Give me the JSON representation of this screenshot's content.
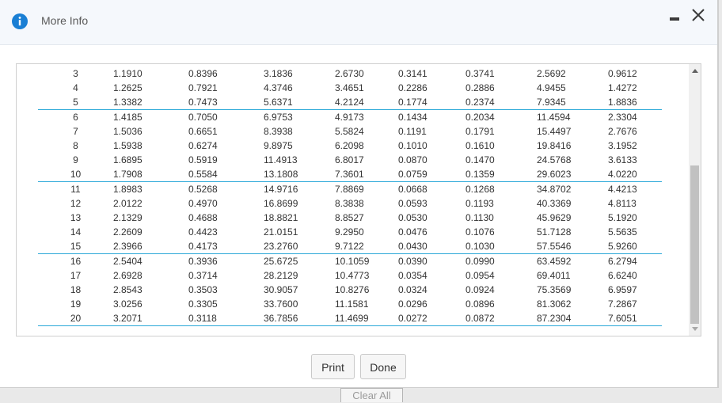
{
  "dialog": {
    "title": "More Info",
    "print_label": "Print",
    "done_label": "Done"
  },
  "underlay": {
    "clear_all_label": "Clear All"
  },
  "colors": {
    "info_icon": "#1a7fd4",
    "row_separator": "#2aa8d8"
  },
  "table": {
    "rows": [
      [
        "3",
        "1.1910",
        "0.8396",
        "3.1836",
        "2.6730",
        "0.3141",
        "0.3741",
        "2.5692",
        "0.9612"
      ],
      [
        "4",
        "1.2625",
        "0.7921",
        "4.3746",
        "3.4651",
        "0.2286",
        "0.2886",
        "4.9455",
        "1.4272"
      ],
      [
        "5",
        "1.3382",
        "0.7473",
        "5.6371",
        "4.2124",
        "0.1774",
        "0.2374",
        "7.9345",
        "1.8836"
      ],
      [
        "6",
        "1.4185",
        "0.7050",
        "6.9753",
        "4.9173",
        "0.1434",
        "0.2034",
        "11.4594",
        "2.3304"
      ],
      [
        "7",
        "1.5036",
        "0.6651",
        "8.3938",
        "5.5824",
        "0.1191",
        "0.1791",
        "15.4497",
        "2.7676"
      ],
      [
        "8",
        "1.5938",
        "0.6274",
        "9.8975",
        "6.2098",
        "0.1010",
        "0.1610",
        "19.8416",
        "3.1952"
      ],
      [
        "9",
        "1.6895",
        "0.5919",
        "11.4913",
        "6.8017",
        "0.0870",
        "0.1470",
        "24.5768",
        "3.6133"
      ],
      [
        "10",
        "1.7908",
        "0.5584",
        "13.1808",
        "7.3601",
        "0.0759",
        "0.1359",
        "29.6023",
        "4.0220"
      ],
      [
        "11",
        "1.8983",
        "0.5268",
        "14.9716",
        "7.8869",
        "0.0668",
        "0.1268",
        "34.8702",
        "4.4213"
      ],
      [
        "12",
        "2.0122",
        "0.4970",
        "16.8699",
        "8.3838",
        "0.0593",
        "0.1193",
        "40.3369",
        "4.8113"
      ],
      [
        "13",
        "2.1329",
        "0.4688",
        "18.8821",
        "8.8527",
        "0.0530",
        "0.1130",
        "45.9629",
        "5.1920"
      ],
      [
        "14",
        "2.2609",
        "0.4423",
        "21.0151",
        "9.2950",
        "0.0476",
        "0.1076",
        "51.7128",
        "5.5635"
      ],
      [
        "15",
        "2.3966",
        "0.4173",
        "23.2760",
        "9.7122",
        "0.0430",
        "0.1030",
        "57.5546",
        "5.9260"
      ],
      [
        "16",
        "2.5404",
        "0.3936",
        "25.6725",
        "10.1059",
        "0.0390",
        "0.0990",
        "63.4592",
        "6.2794"
      ],
      [
        "17",
        "2.6928",
        "0.3714",
        "28.2129",
        "10.4773",
        "0.0354",
        "0.0954",
        "69.4011",
        "6.6240"
      ],
      [
        "18",
        "2.8543",
        "0.3503",
        "30.9057",
        "10.8276",
        "0.0324",
        "0.0924",
        "75.3569",
        "6.9597"
      ],
      [
        "19",
        "3.0256",
        "0.3305",
        "33.7600",
        "11.1581",
        "0.0296",
        "0.0896",
        "81.3062",
        "7.2867"
      ],
      [
        "20",
        "3.2071",
        "0.3118",
        "36.7856",
        "11.4699",
        "0.0272",
        "0.0872",
        "87.2304",
        "7.6051"
      ]
    ],
    "group_end_rows": [
      "5",
      "10",
      "15",
      "20"
    ]
  }
}
